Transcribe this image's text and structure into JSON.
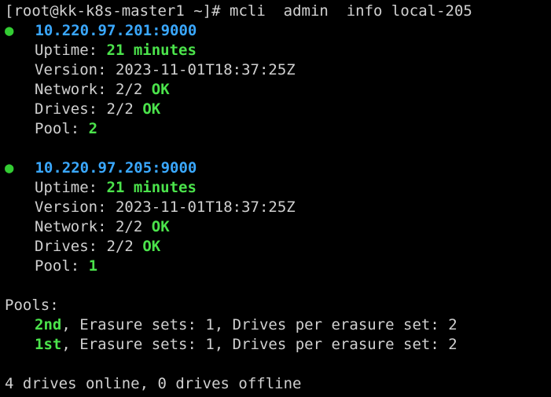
{
  "command_line": {
    "prompt": "[root@kk-k8s-master1 ~]#",
    "command": "mcli  admin  info local-205"
  },
  "servers": [
    {
      "bullet": "●",
      "endpoint": "10.220.97.201:9000",
      "uptime_label": "Uptime:",
      "uptime_value": "21 minutes",
      "version_label": "Version:",
      "version_value": "2023-11-01T18:37:25Z",
      "network_label": "Network:",
      "network_count": "2/2",
      "network_status": "OK",
      "drives_label": "Drives:",
      "drives_count": "2/2",
      "drives_status": "OK",
      "pool_label": "Pool:",
      "pool_value": "2"
    },
    {
      "bullet": "●",
      "endpoint": "10.220.97.205:9000",
      "uptime_label": "Uptime:",
      "uptime_value": "21 minutes",
      "version_label": "Version:",
      "version_value": "2023-11-01T18:37:25Z",
      "network_label": "Network:",
      "network_count": "2/2",
      "network_status": "OK",
      "drives_label": "Drives:",
      "drives_count": "2/2",
      "drives_status": "OK",
      "pool_label": "Pool:",
      "pool_value": "1"
    }
  ],
  "pools": {
    "heading": "Pools:",
    "items": [
      {
        "name": "2nd",
        "details": ", Erasure sets: 1, Drives per erasure set: 2"
      },
      {
        "name": "1st",
        "details": ", Erasure sets: 1, Drives per erasure set: 2"
      }
    ]
  },
  "summary": "4 drives online, 0 drives offline",
  "colors": {
    "background": "#000000",
    "text": "#d0d0d0",
    "green": "#4be34b",
    "cyan": "#3aa8ff",
    "cursor": "#33dd33"
  }
}
